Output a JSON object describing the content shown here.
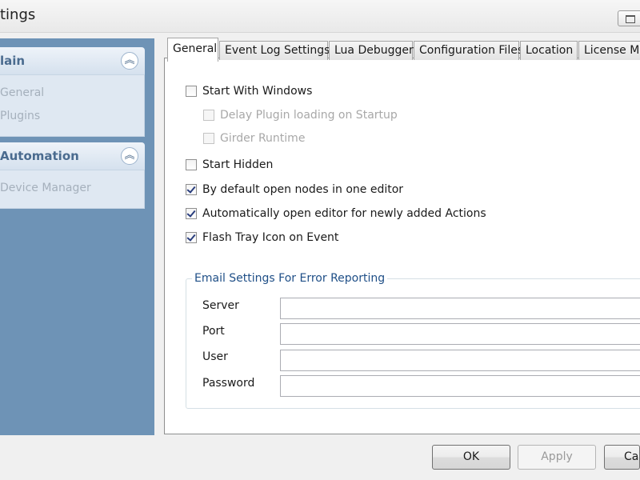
{
  "window": {
    "title": "tings"
  },
  "sidebar": {
    "panels": [
      {
        "header": "lain",
        "items": [
          "General",
          "Plugins"
        ]
      },
      {
        "header": "Automation",
        "items": [
          "Device Manager"
        ]
      }
    ]
  },
  "tabs": [
    "General",
    "Event Log Settings",
    "Lua Debugger",
    "Configuration Files",
    "Location",
    "License Ma"
  ],
  "general": {
    "options": [
      {
        "label": "Start With Windows",
        "checked": false,
        "enabled": true
      },
      {
        "label": "Delay Plugin loading on Startup",
        "checked": false,
        "enabled": false
      },
      {
        "label": "Girder Runtime",
        "checked": false,
        "enabled": false
      },
      {
        "label": "Start Hidden",
        "checked": false,
        "enabled": true
      },
      {
        "label": "By default open nodes in one editor",
        "checked": true,
        "enabled": true
      },
      {
        "label": "Automatically open editor for newly added Actions",
        "checked": true,
        "enabled": true
      },
      {
        "label": "Flash Tray Icon on Event",
        "checked": true,
        "enabled": true
      }
    ],
    "email": {
      "legend": "Email Settings For Error Reporting",
      "fields": [
        {
          "label": "Server",
          "value": ""
        },
        {
          "label": "Port",
          "value": ""
        },
        {
          "label": "User",
          "value": ""
        },
        {
          "label": "Password",
          "value": ""
        }
      ]
    }
  },
  "buttons": {
    "ok": "OK",
    "apply": "Apply",
    "cancel": "Ca"
  }
}
